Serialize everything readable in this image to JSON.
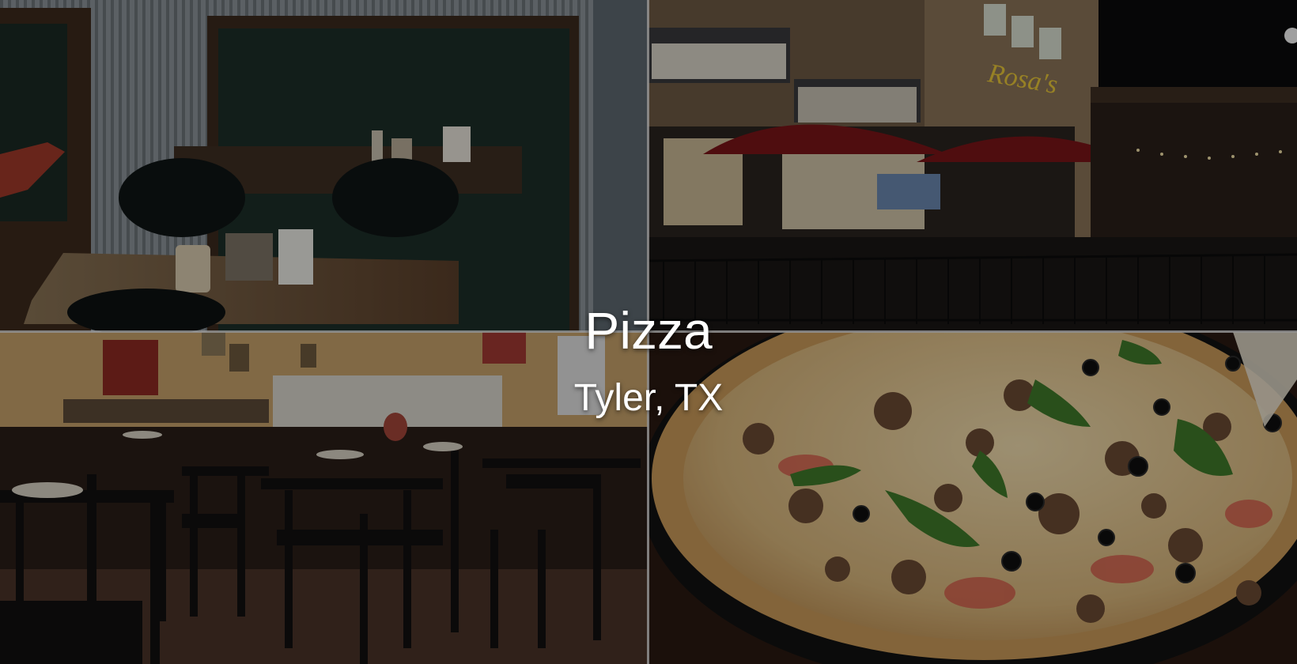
{
  "hero": {
    "title": "Pizza",
    "subtitle": "Tyler, TX"
  },
  "photos": [
    {
      "name": "booth-interior-photo"
    },
    {
      "name": "restaurant-exterior-night-photo"
    },
    {
      "name": "dining-room-photo"
    },
    {
      "name": "supreme-pizza-photo"
    }
  ],
  "colors": {
    "text": "#ffffff",
    "divider": "#9a9a9a",
    "umbrella": "#7a1418",
    "signage": "#e8c63a"
  }
}
